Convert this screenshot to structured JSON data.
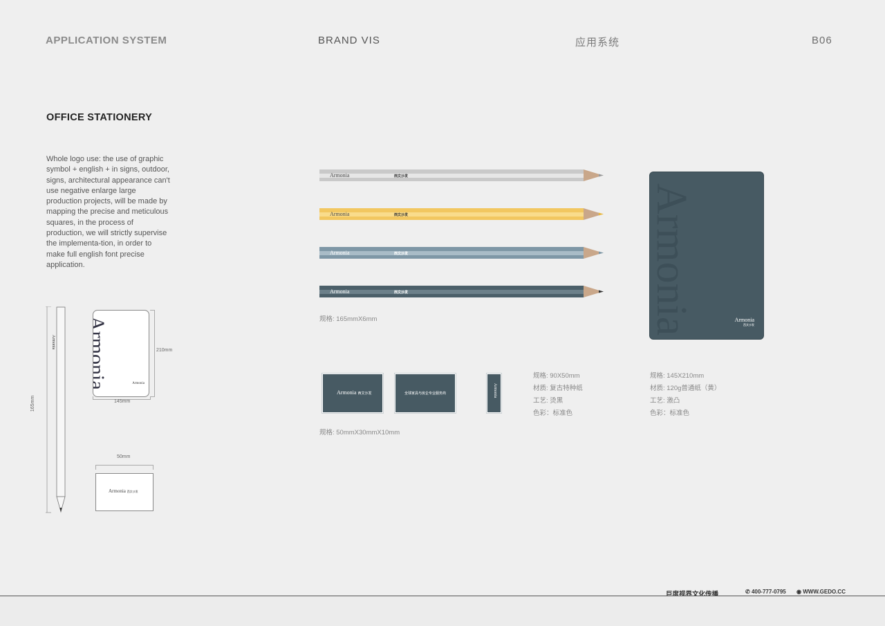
{
  "header": {
    "left": "APPLICATION SYSTEM",
    "center": "BRAND VIS",
    "right_cn": "应用系统",
    "page": "B06"
  },
  "section": {
    "title": "OFFICE STATIONERY",
    "description": "Whole logo use: the use of graphic symbol + english + in signs, outdoor, signs, architectural appearance can't use negative enlarge large production projects, will be made by mapping the precise and meticulous squares, in the process of production, we will strictly supervise the implementa-tion, in order to make full english font precise application."
  },
  "brand": {
    "name": "Armonia",
    "cn": "西文沙发",
    "tagline_cn": "全球家具与房企专业服务商"
  },
  "drawings": {
    "pencil_length": "165mm",
    "notebook_height": "210mm",
    "notebook_width": "145mm",
    "box_width": "50mm"
  },
  "pencils": {
    "spec": "规格: 165mmX6mm",
    "items": [
      {
        "color": "#c9c9c9",
        "stripe": "#e6e6e6"
      },
      {
        "color": "#f2c760",
        "stripe": "#f9dc8c"
      },
      {
        "color": "#7e97a6",
        "stripe": "#a9bcc7"
      },
      {
        "color": "#4b5f69",
        "stripe": "#6c808a"
      }
    ]
  },
  "cards": {
    "spec": "规格: 50mmX30mmX10mm",
    "details": [
      "规格: 90X50mm",
      "材质: 复古特种纸",
      "工艺: 烫黑",
      "色彩：标准色"
    ]
  },
  "notebook": {
    "details": [
      "规格: 145X210mm",
      "材质: 120g普通纸（黄）",
      "工艺: 激凸",
      "色彩：标准色"
    ]
  },
  "footer": {
    "company": "巨度视界文化传播",
    "phone": "400-777-0795",
    "web": "WWW.GEDO.CC"
  },
  "colors": {
    "background": "#efefef",
    "brand_dark": "#475a63"
  }
}
